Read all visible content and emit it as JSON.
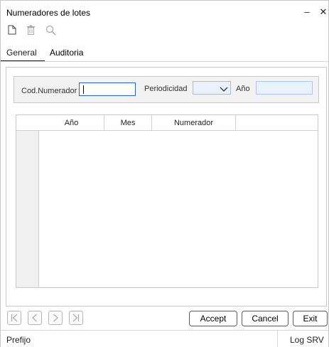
{
  "window": {
    "title": "Numeradores de lotes",
    "minimize_glyph": "–",
    "close_glyph": "✕"
  },
  "toolbar": {
    "icons": [
      "new-document-icon",
      "delete-icon",
      "search-icon"
    ]
  },
  "tabs": {
    "general": "General",
    "auditoria": "Auditoria"
  },
  "filter": {
    "cod_numerador_label": "Cod.Numerador",
    "cod_numerador_value": "",
    "periodicidad_label": "Periodicidad",
    "periodicidad_value": "",
    "anio_label": "Año",
    "anio_value": ""
  },
  "grid": {
    "columns": [
      "Año",
      "Mes",
      "Numerador"
    ],
    "rows": []
  },
  "nav": {
    "icons": [
      "first-record-icon",
      "previous-record-icon",
      "next-record-icon",
      "last-record-icon"
    ]
  },
  "buttons": {
    "accept": "Accept",
    "cancel": "Cancel",
    "exit": "Exit"
  },
  "status": {
    "left": "Prefijo",
    "right": "Log SRV"
  },
  "colors": {
    "input_focus_border": "#2a64b8",
    "input_fill": "#e8f2fd"
  }
}
